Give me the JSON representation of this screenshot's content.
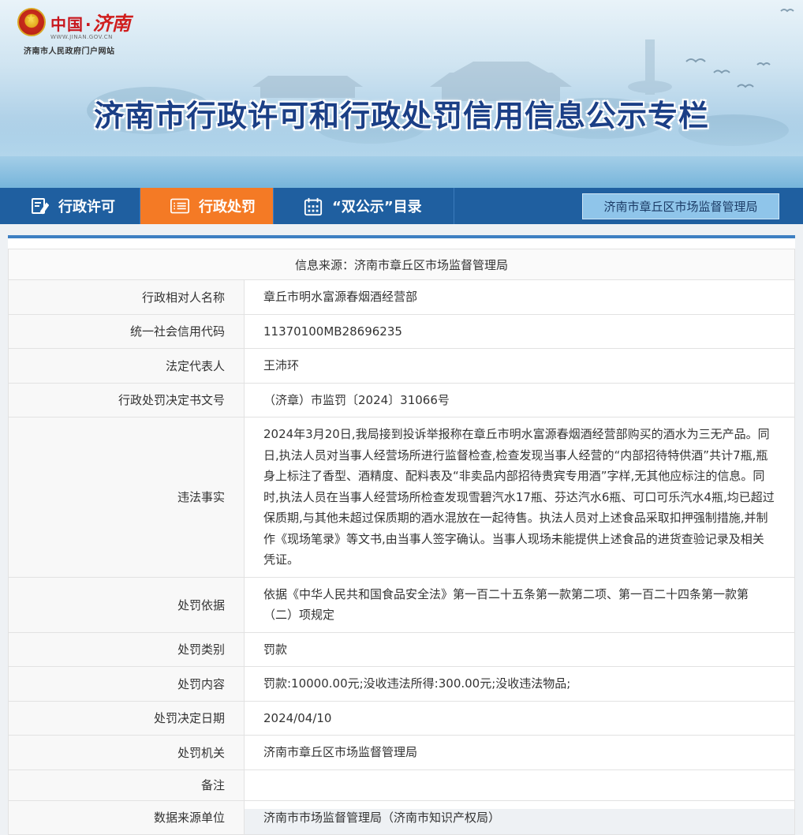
{
  "site": {
    "logo_china": "中国",
    "logo_dot": "·",
    "logo_city": "济南",
    "logo_url": "WWW.JINAN.GOV.CN",
    "logo_subtitle": "济南市人民政府门户网站",
    "banner_title": "济南市行政许可和行政处罚信用信息公示专栏"
  },
  "nav": {
    "items": [
      {
        "label": "行政许可",
        "icon": "edit-document-icon",
        "active": false
      },
      {
        "label": "行政处罚",
        "icon": "list-icon",
        "active": true
      },
      {
        "label": "“双公示”目录",
        "icon": "calendar-icon",
        "active": false
      }
    ],
    "department": "济南市章丘区市场监督管理局"
  },
  "record": {
    "source_line": "信息来源：济南市章丘区市场监督管理局",
    "rows": [
      {
        "label": "行政相对人名称",
        "value": "章丘市明水富源春烟酒经营部"
      },
      {
        "label": "统一社会信用代码",
        "value": "11370100MB28696235"
      },
      {
        "label": "法定代表人",
        "value": "王沛环"
      },
      {
        "label": "行政处罚决定书文号",
        "value": "（济章）市监罚〔2024〕31066号"
      },
      {
        "label": "违法事实",
        "value": "2024年3月20日,我局接到投诉举报称在章丘市明水富源春烟酒经营部购买的酒水为三无产品。同日,执法人员对当事人经营场所进行监督检查,检查发现当事人经营的“内部招待特供酒”共计7瓶,瓶身上标注了香型、酒精度、配料表及“非卖品内部招待贵宾专用酒”字样,无其他应标注的信息。同时,执法人员在当事人经营场所检查发现雪碧汽水17瓶、芬达汽水6瓶、可口可乐汽水4瓶,均已超过保质期,与其他未超过保质期的酒水混放在一起待售。执法人员对上述食品采取扣押强制措施,并制作《现场笔录》等文书,由当事人签字确认。当事人现场未能提供上述食品的进货查验记录及相关凭证。"
      },
      {
        "label": "处罚依据",
        "value": "依据《中华人民共和国食品安全法》第一百二十五条第一款第二项、第一百二十四条第一款第（二）项规定"
      },
      {
        "label": "处罚类别",
        "value": "罚款"
      },
      {
        "label": "处罚内容",
        "value": "罚款:10000.00元;没收违法所得:300.00元;没收违法物品;"
      },
      {
        "label": "处罚决定日期",
        "value": "2024/04/10"
      },
      {
        "label": "处罚机关",
        "value": "济南市章丘区市场监督管理局"
      },
      {
        "label": "备注",
        "value": ""
      },
      {
        "label": "数据来源单位",
        "value": "济南市市场监督管理局（济南市知识产权局）"
      }
    ]
  }
}
